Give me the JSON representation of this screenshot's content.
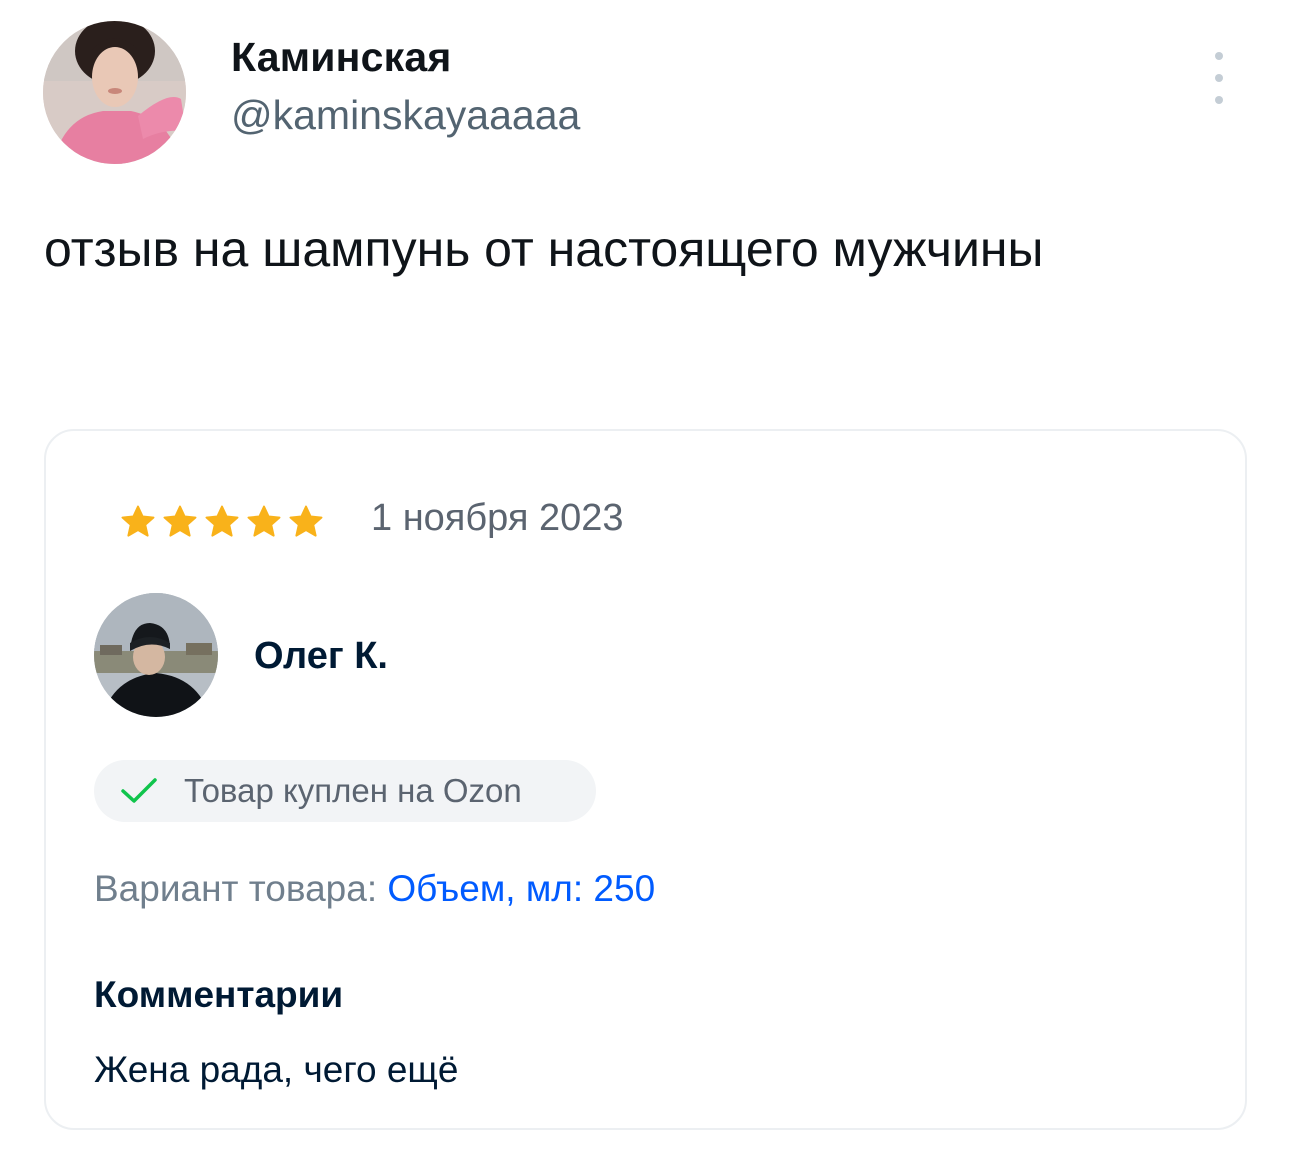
{
  "tweet": {
    "author_name": "Каминская",
    "author_handle": "@kaminskayaaaaa",
    "text": "отзыв на шампунь от настоящего мужчины",
    "more_icon": "more-vertical-icon"
  },
  "review": {
    "rating": 5,
    "rating_max": 5,
    "date": "1 ноября 2023",
    "reviewer_name": "Олег К.",
    "purchase_badge": "Товар куплен на Ozon",
    "variant_label": "Вариант товара:",
    "variant_value": "Объем, мл: 250",
    "comments_heading": "Комментарии",
    "comment_text": "Жена рада, чего ещё"
  },
  "colors": {
    "star": "#f9b21a",
    "link_blue": "#005bff",
    "check_green": "#10c44c"
  }
}
